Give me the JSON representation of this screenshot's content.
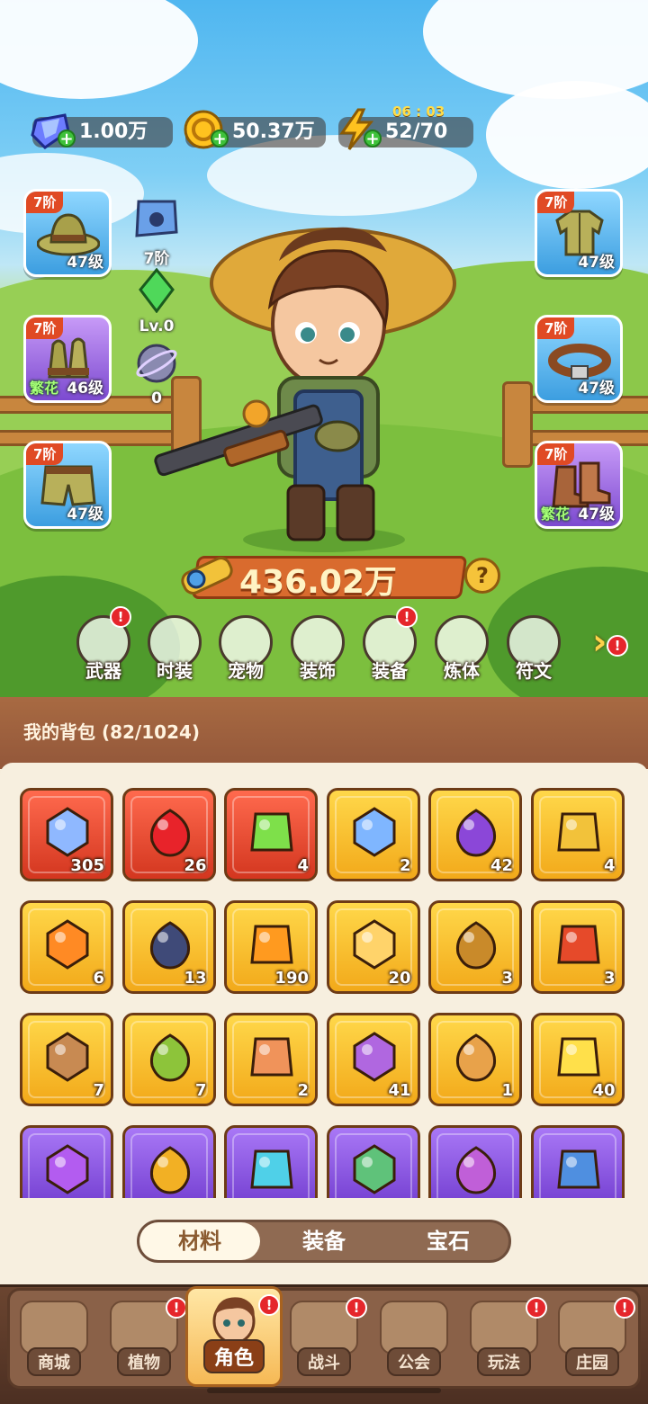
{
  "currencies": [
    {
      "id": "diamond",
      "icon": "diamond-icon",
      "value": "1.00万"
    },
    {
      "id": "gold",
      "icon": "gold-coin-icon",
      "value": "50.37万"
    },
    {
      "id": "energy",
      "icon": "lightning-icon",
      "value": "52/70",
      "timer": "06 : 03"
    }
  ],
  "equipment_left": [
    {
      "slot": "hat",
      "tier": "7阶",
      "level": "47级",
      "quality": "blue",
      "tag": ""
    },
    {
      "slot": "gloves",
      "tier": "7阶",
      "level": "46级",
      "quality": "purple",
      "tag": "繁花"
    },
    {
      "slot": "pants",
      "tier": "7阶",
      "level": "47级",
      "quality": "blue",
      "tag": ""
    }
  ],
  "equipment_right": [
    {
      "slot": "jacket",
      "tier": "7阶",
      "level": "47级",
      "quality": "blue",
      "tag": ""
    },
    {
      "slot": "belt",
      "tier": "7阶",
      "level": "47级",
      "quality": "blue",
      "tag": ""
    },
    {
      "slot": "boots",
      "tier": "7阶",
      "level": "47级",
      "quality": "purple",
      "tag": "繁花"
    }
  ],
  "side_stats": [
    {
      "icon": "paw-badge-icon",
      "label": "7阶"
    },
    {
      "icon": "green-crystal-icon",
      "label": "Lv.0"
    },
    {
      "icon": "orbit-orb-icon",
      "label": "0"
    }
  ],
  "power": {
    "value": "436.02万",
    "help": "?"
  },
  "functions": [
    {
      "label": "武器",
      "icon": "gun-icon",
      "badge": true
    },
    {
      "label": "时装",
      "icon": "shirt-icon",
      "badge": false
    },
    {
      "label": "宠物",
      "icon": "pet-cat-icon",
      "badge": false
    },
    {
      "label": "装饰",
      "icon": "mask-icon",
      "badge": false
    },
    {
      "label": "装备",
      "icon": "shovel-icon",
      "badge": true
    },
    {
      "label": "炼体",
      "icon": "body-icon",
      "badge": false
    },
    {
      "label": "符文",
      "icon": "rune-icon",
      "badge": false
    }
  ],
  "bag": {
    "title": "我的背包 (82/1024)",
    "items": [
      {
        "name": "star-crystal",
        "count": "305",
        "quality": "red",
        "color": "#8fb8ff"
      },
      {
        "name": "red-potion",
        "count": "26",
        "quality": "red",
        "color": "#e8232a"
      },
      {
        "name": "green-capsule",
        "count": "4",
        "quality": "red",
        "color": "#7ee04a"
      },
      {
        "name": "water-drop",
        "count": "2",
        "quality": "gold",
        "color": "#7fb6ff"
      },
      {
        "name": "skull-scroll",
        "count": "42",
        "quality": "gold",
        "color": "#8b47d8"
      },
      {
        "name": "golden-key",
        "count": "4",
        "quality": "gold",
        "color": "#f2c23a"
      },
      {
        "name": "fire-prism",
        "count": "6",
        "quality": "gold",
        "color": "#ff8a24"
      },
      {
        "name": "rune-stone",
        "count": "13",
        "quality": "gold",
        "color": "#3f4a78"
      },
      {
        "name": "orange-potion",
        "count": "190",
        "quality": "gold",
        "color": "#ff9a1f"
      },
      {
        "name": "gold-crystals",
        "count": "20",
        "quality": "gold",
        "color": "#ffd36a"
      },
      {
        "name": "gold-ore",
        "count": "3",
        "quality": "gold",
        "color": "#c98a2a"
      },
      {
        "name": "red-flower",
        "count": "3",
        "quality": "gold",
        "color": "#e64a2a"
      },
      {
        "name": "flower-pot",
        "count": "7",
        "quality": "gold",
        "color": "#c88a52"
      },
      {
        "name": "sprayer",
        "count": "7",
        "quality": "gold",
        "color": "#8dc43a"
      },
      {
        "name": "cake",
        "count": "2",
        "quality": "gold",
        "color": "#f0935a"
      },
      {
        "name": "magic-book",
        "count": "41",
        "quality": "gold",
        "color": "#b067e0"
      },
      {
        "name": "can",
        "count": "1",
        "quality": "gold",
        "color": "#e8a24a"
      },
      {
        "name": "lily",
        "count": "40",
        "quality": "gold",
        "color": "#ffe04a"
      },
      {
        "name": "purple-bottle",
        "count": "",
        "quality": "purple",
        "color": "#b35cf0"
      },
      {
        "name": "hex-token",
        "count": "",
        "quality": "purple",
        "color": "#f2b024"
      },
      {
        "name": "leaf",
        "count": "",
        "quality": "purple",
        "color": "#4fd0e8"
      },
      {
        "name": "scroll-a",
        "count": "",
        "quality": "purple",
        "color": "#5fc27a"
      },
      {
        "name": "scroll-b",
        "count": "",
        "quality": "purple",
        "color": "#c05fd8"
      },
      {
        "name": "scroll-c",
        "count": "",
        "quality": "purple",
        "color": "#4f8fe0"
      }
    ]
  },
  "tabs": [
    {
      "label": "材料",
      "active": true
    },
    {
      "label": "装备",
      "active": false
    },
    {
      "label": "宝石",
      "active": false
    }
  ],
  "nav": [
    {
      "label": "商城",
      "icon": "shop-icon",
      "badge": false,
      "active": false
    },
    {
      "label": "植物",
      "icon": "plant-icon",
      "badge": true,
      "active": false
    },
    {
      "label": "角色",
      "icon": "character-icon",
      "badge": true,
      "active": true
    },
    {
      "label": "战斗",
      "icon": "battle-icon",
      "badge": true,
      "active": false
    },
    {
      "label": "公会",
      "icon": "guild-icon",
      "badge": false,
      "active": false
    },
    {
      "label": "玩法",
      "icon": "gameplay-icon",
      "badge": true,
      "active": false
    },
    {
      "label": "庄园",
      "icon": "manor-icon",
      "badge": true,
      "active": false
    }
  ],
  "badge_symbol": "!",
  "colors": {
    "accent": "#e04a24",
    "badge": "#e5262b",
    "bag_header": "#a86a42"
  }
}
